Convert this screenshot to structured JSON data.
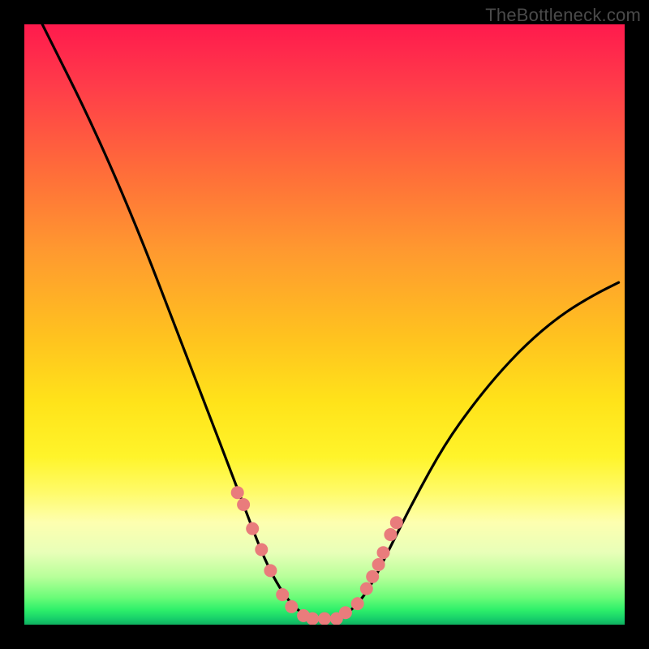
{
  "watermark": "TheBottleneck.com",
  "colors": {
    "curve_stroke": "#000000",
    "marker_fill": "#e97c7c",
    "frame_border": "#000000"
  },
  "chart_data": {
    "type": "line",
    "title": "",
    "xlabel": "",
    "ylabel": "",
    "xlim": [
      0,
      100
    ],
    "ylim": [
      0,
      100
    ],
    "series": [
      {
        "name": "bottleneck-curve",
        "x": [
          3,
          5,
          10,
          15,
          20,
          25,
          30,
          35,
          38,
          40,
          42,
          44,
          46,
          48,
          50,
          52,
          54,
          56,
          58,
          60,
          65,
          70,
          75,
          80,
          85,
          90,
          95,
          99
        ],
        "y": [
          100,
          96,
          86,
          75,
          63,
          50,
          37,
          24,
          16,
          11,
          7,
          4,
          2,
          1,
          1,
          1,
          2,
          4,
          7,
          11,
          21,
          30,
          37,
          43,
          48,
          52,
          55,
          57
        ]
      }
    ],
    "markers": {
      "name": "highlighted-points",
      "x": [
        35.5,
        36.5,
        38.0,
        39.5,
        41.0,
        43.0,
        44.5,
        46.5,
        48.0,
        50.0,
        52.0,
        53.5,
        55.5,
        57.0,
        58.0,
        59.0,
        59.8,
        61.0,
        62.0
      ],
      "y": [
        22,
        20,
        16,
        12.5,
        9,
        5,
        3,
        1.5,
        1,
        1,
        1,
        2,
        3.5,
        6,
        8,
        10,
        12,
        15,
        17
      ]
    }
  }
}
